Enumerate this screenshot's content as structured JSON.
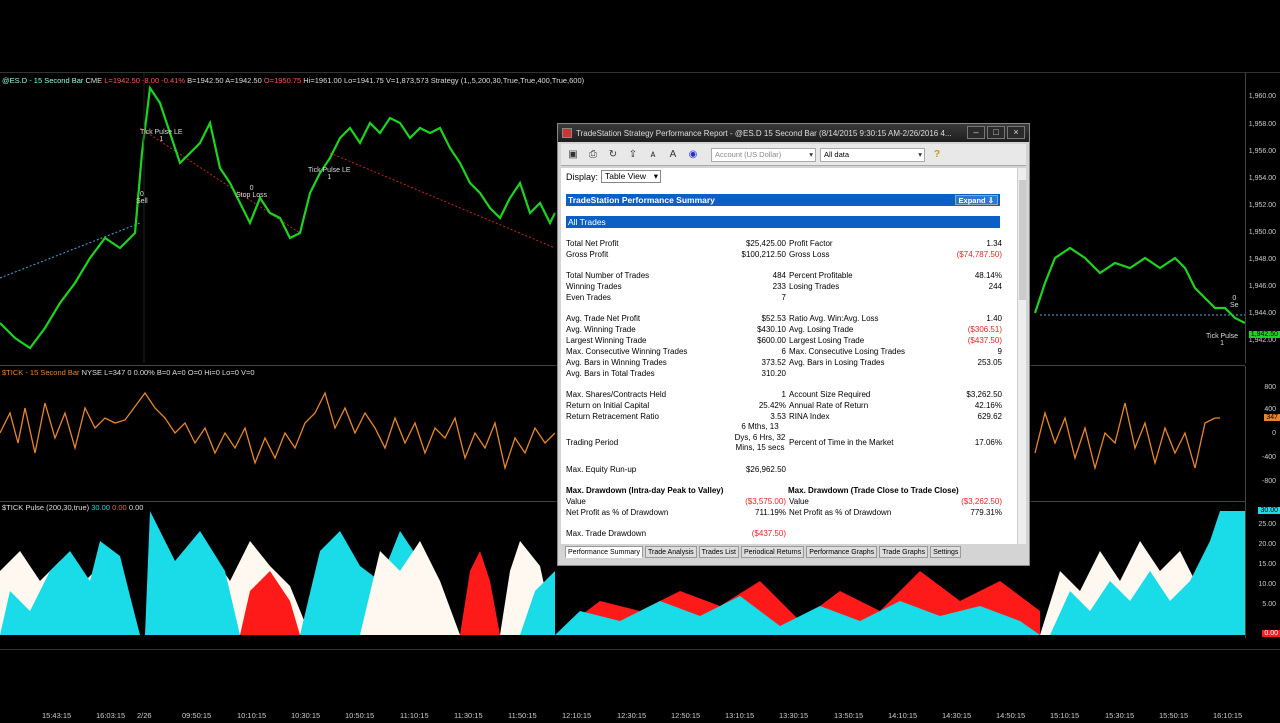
{
  "pane1": {
    "header": {
      "sym": "@ES.D - 15 Second Bar",
      "exch": "CME",
      "last": "L=1942.50",
      "chg": "-8.00",
      "pct": "-0.41%",
      "bid": "B=1942.50",
      "ask": "A=1942.50",
      "open": "O=1950.75",
      "hi": "Hi=1961.00",
      "lo": "Lo=1941.75",
      "vol": "V=1,873,573",
      "strategy": "Strategy (1,,5,200,30,True,True,400,True,600)"
    },
    "axis": [
      "1,960.00",
      "1,958.00",
      "1,956.00",
      "1,954.00",
      "1,952.00",
      "1,950.00",
      "1,948.00",
      "1,946.00",
      "1,944.00",
      "1,942.00"
    ],
    "price_tag": "1,942.50",
    "annotations": [
      {
        "id": "tick-pulse-le-1",
        "text": "Tick Pulse LE\n1"
      },
      {
        "id": "sell-1",
        "text": "0\nSell"
      },
      {
        "id": "stop-loss-1",
        "text": "0\nStop Loss"
      },
      {
        "id": "tick-pulse-le-2",
        "text": "Tick Pulse LE\n1"
      },
      {
        "id": "tick-pulse-right",
        "text": "Tick Pulse\n1"
      },
      {
        "id": "se-right",
        "text": "0\nSe"
      }
    ]
  },
  "pane2": {
    "header": {
      "sym": "$TICK - 15 Second Bar",
      "exch": "NYSE",
      "vals": "L=347  0  0.00%  B=0  A=0  O=0  Hi=0  Lo=0  V=0"
    },
    "axis": [
      "800",
      "400",
      "0",
      "-400",
      "-800"
    ],
    "tag": "347"
  },
  "pane3": {
    "header": {
      "name": "$TICK Pulse (200,30,true)",
      "v1": "30.00",
      "v2": "0.00",
      "v3": "0.00"
    },
    "axis": [
      "30.00",
      "25.00",
      "20.00",
      "15.00",
      "10.00",
      "5.00",
      "0.00"
    ],
    "tag": "30.00"
  },
  "xaxis": [
    "15:43:15",
    "16:03:15",
    "2/26",
    "09:50:15",
    "10:10:15",
    "10:30:15",
    "10:50:15",
    "11:10:15",
    "11:30:15",
    "11:50:15",
    "12:10:15",
    "12:30:15",
    "12:50:15",
    "13:10:15",
    "13:30:15",
    "13:50:15",
    "14:10:15",
    "14:30:15",
    "14:50:15",
    "15:10:15",
    "15:30:15",
    "15:50:15",
    "16:10:15"
  ],
  "window": {
    "title": "TradeStation Strategy Performance Report - @ES.D 15 Second Bar (8/14/2015 9:30:15 AM-2/26/2016 4...",
    "account_dd": "Account (US Dollar)",
    "data_dd": "All data",
    "display_label": "Display:",
    "display_value": "Table View",
    "summary_title": "TradeStation Performance Summary",
    "expand_label": "Expand ⇩",
    "all_trades": "All Trades",
    "left": [
      {
        "l": "Total Net Profit",
        "v": "$25,425.00"
      },
      {
        "l": "Gross Profit",
        "v": "$100,212.50"
      },
      {
        "l": "Total Number of Trades",
        "v": "484"
      },
      {
        "l": "Winning Trades",
        "v": "233"
      },
      {
        "l": "Even Trades",
        "v": "7"
      },
      {
        "l": "Avg. Trade Net Profit",
        "v": "$52.53"
      },
      {
        "l": "Avg. Winning Trade",
        "v": "$430.10"
      },
      {
        "l": "Largest Winning Trade",
        "v": "$600.00"
      },
      {
        "l": "Max. Consecutive Winning Trades",
        "v": "6"
      },
      {
        "l": "Avg. Bars in Winning Trades",
        "v": "373.52"
      },
      {
        "l": "Avg. Bars in Total Trades",
        "v": "310.20"
      },
      {
        "l": "Max. Shares/Contracts Held",
        "v": "1"
      },
      {
        "l": "Return on Initial Capital",
        "v": "25.42%"
      },
      {
        "l": "Return Retracement Ratio",
        "v": "3.53"
      },
      {
        "l": "Trading Period",
        "v": "6 Mths, 13 Dys, 6 Hrs, 32 Mins, 15 secs"
      },
      {
        "l": "Max. Equity Run-up",
        "v": "$26,962.50"
      }
    ],
    "right": [
      {
        "l": "Profit Factor",
        "v": "1.34"
      },
      {
        "l": "Gross Loss",
        "v": "($74,787.50)"
      },
      {
        "l": "Percent Profitable",
        "v": "48.14%"
      },
      {
        "l": "Losing Trades",
        "v": "244"
      },
      {
        "l": "Ratio Avg. Win:Avg. Loss",
        "v": "1.40"
      },
      {
        "l": "Avg. Losing Trade",
        "v": "($306.51)"
      },
      {
        "l": "Largest Losing Trade",
        "v": "($437.50)"
      },
      {
        "l": "Max. Consecutive Losing Trades",
        "v": "9"
      },
      {
        "l": "Avg. Bars in Losing Trades",
        "v": "253.05"
      },
      {
        "l": "Account Size Required",
        "v": "$3,262.50"
      },
      {
        "l": "Annual Rate of Return",
        "v": "42.16%"
      },
      {
        "l": "RINA Index",
        "v": "629.62"
      },
      {
        "l": "Percent of Time in the Market",
        "v": "17.06%"
      }
    ],
    "dd_left_title": "Max. Drawdown (Intra-day Peak to Valley)",
    "dd_left": [
      {
        "l": "Value",
        "v": "($3,575.00)"
      },
      {
        "l": "Net Profit as % of Drawdown",
        "v": "711.19%"
      }
    ],
    "dd_right_title": "Max. Drawdown (Trade Close to Trade Close)",
    "dd_right": [
      {
        "l": "Value",
        "v": "($3,262.50)"
      },
      {
        "l": "Net Profit as % of Drawdown",
        "v": "779.31%"
      }
    ],
    "max_trade_dd_label": "Max. Trade Drawdown",
    "max_trade_dd": "($437.50)",
    "tabs": [
      "Performance Summary",
      "Trade Analysis",
      "Trades List",
      "Periodical Returns",
      "Performance Graphs",
      "Trade Graphs",
      "Settings"
    ]
  }
}
